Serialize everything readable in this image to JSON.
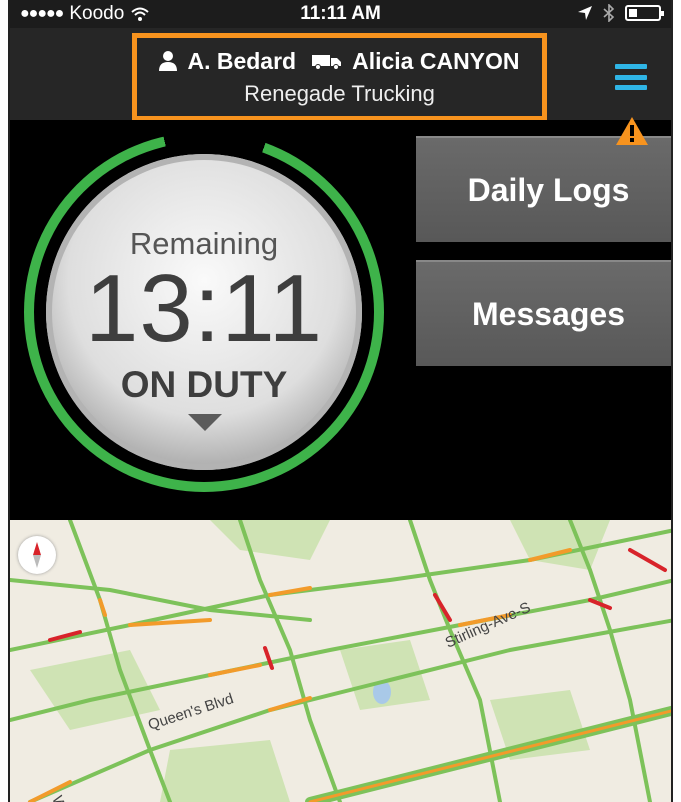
{
  "status_bar": {
    "signal": "●●●●●",
    "carrier": "Koodo",
    "time": "11:11 AM"
  },
  "header": {
    "driver_name": "A. Bedard",
    "vehicle_name": "Alicia CANYON",
    "company": "Renegade Trucking",
    "icons": [
      "person-icon",
      "truck-icon",
      "menu-icon"
    ]
  },
  "duty_clock": {
    "label": "Remaining",
    "time_remaining": "13:11",
    "status": "ON DUTY",
    "ring_fraction": 0.91
  },
  "buttons": {
    "daily_logs": "Daily Logs",
    "messages": "Messages"
  },
  "map": {
    "streets": [
      "Stirling-Ave-S",
      "Queen's Blvd",
      "Westh"
    ]
  },
  "colors": {
    "accent_orange": "#f7931e",
    "ring_green": "#3eb34a",
    "menu_blue": "#2fb5e6",
    "traffic_green": "#7dc25a",
    "traffic_orange": "#f29b2b",
    "traffic_red": "#d8232a"
  }
}
